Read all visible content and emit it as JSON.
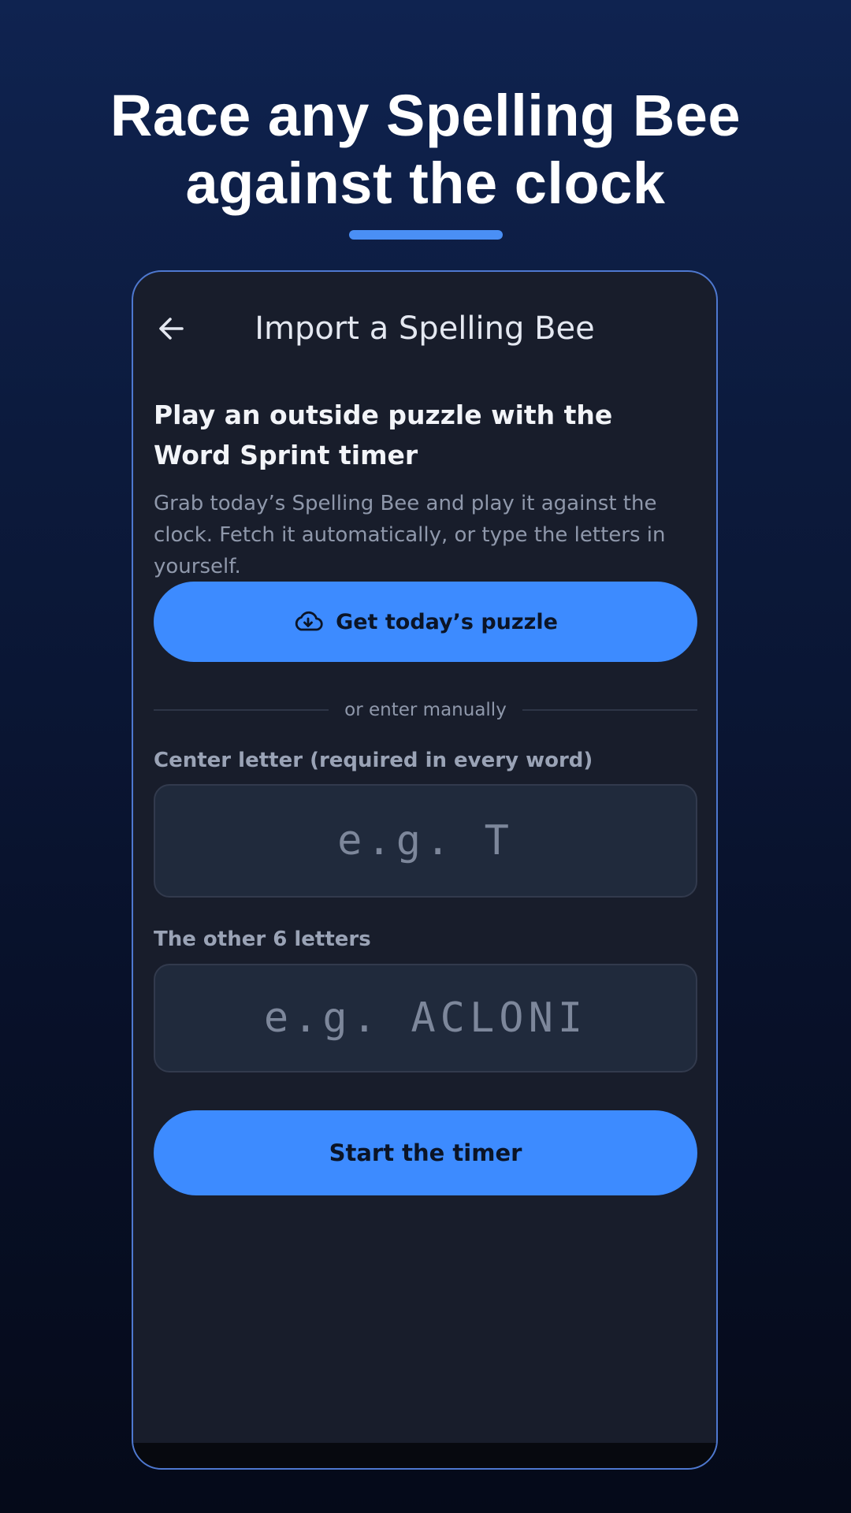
{
  "headline": {
    "line1": "Race any Spelling Bee",
    "line2": "against the clock"
  },
  "colors": {
    "accent": "#3d8bff",
    "underline": "#4a8ff5",
    "screen_background": "#181d2b",
    "frame_border": "#4e78cf"
  },
  "app_bar": {
    "back_icon": "arrow-left-icon",
    "title": "Import a Spelling Bee"
  },
  "intro": {
    "title": "Play an outside puzzle with the Word Sprint timer",
    "body": "Grab today’s Spelling Bee and play it against the clock. Fetch it automatically, or type the letters in yourself."
  },
  "fetch_button": {
    "icon": "cloud-download-icon",
    "label": "Get today’s puzzle"
  },
  "divider": {
    "text": "or enter manually"
  },
  "center_letter": {
    "label": "Center letter (required in every word)",
    "placeholder": "e.g. T",
    "value": ""
  },
  "other_letters": {
    "label": "The other 6 letters",
    "placeholder": "e.g. ACLONI",
    "value": ""
  },
  "start_button": {
    "label": "Start the timer"
  }
}
